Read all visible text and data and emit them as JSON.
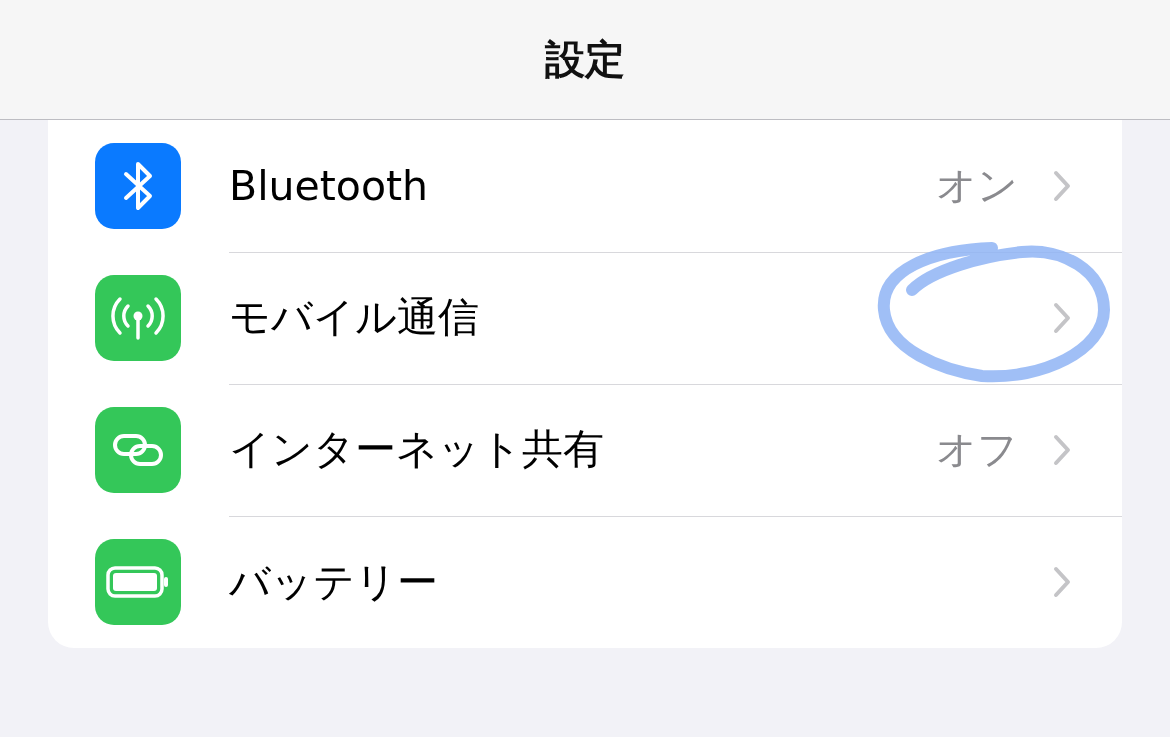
{
  "nav_bar": {
    "title": "設定"
  },
  "rows": [
    {
      "kind": "bluetooth",
      "label": "Bluetooth",
      "value": "オン",
      "color": "#0a7aff",
      "circled": false
    },
    {
      "kind": "cellular",
      "label": "モバイル通信",
      "color": "#34c759",
      "circled": true
    },
    {
      "kind": "hotspot",
      "label": "インターネット共有",
      "value": "オフ",
      "color": "#34c759",
      "circled": false
    },
    {
      "kind": "battery",
      "label": "バッテリー",
      "color": "#34c759",
      "circled": false
    }
  ]
}
